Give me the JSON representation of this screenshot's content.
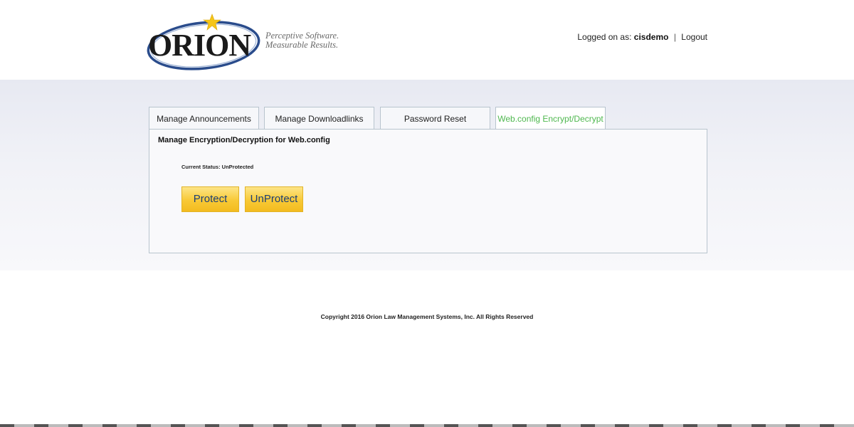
{
  "header": {
    "logo_text": "ORION",
    "tagline_line1": "Perceptive Software.",
    "tagline_line2": "Measurable Results.",
    "logged_on_label": "Logged on as:",
    "username": "cisdemo",
    "separator": "|",
    "logout_label": "Logout"
  },
  "tabs": [
    {
      "label": "Manage Announcements",
      "active": false
    },
    {
      "label": "Manage Downloadlinks",
      "active": false
    },
    {
      "label": "Password Reset",
      "active": false
    },
    {
      "label": "Web.config Encrypt/Decrypt",
      "active": true
    }
  ],
  "panel": {
    "title": "Manage Encryption/Decryption for Web.config",
    "status": "Current Status: UnProtected",
    "protect_label": "Protect",
    "unprotect_label": "UnProtect"
  },
  "footer": {
    "copyright": "Copyright 2016 Orion Law Management Systems, Inc. All Rights Reserved"
  },
  "colors": {
    "active_tab": "#4fb84f",
    "button_gold": "#f8c936",
    "button_text": "#1c3f75",
    "logo_blue": "#2a4c8c",
    "logo_star": "#f5c518"
  }
}
